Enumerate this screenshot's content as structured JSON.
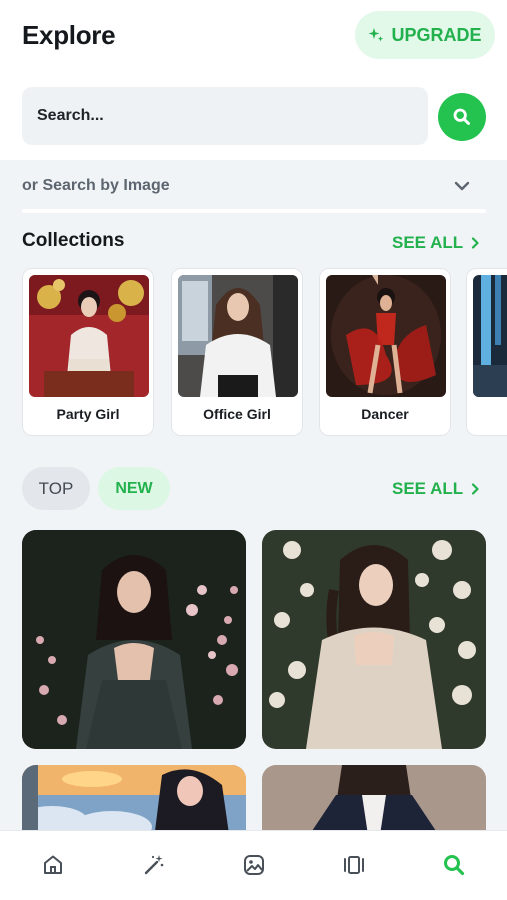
{
  "header": {
    "title": "Explore",
    "upgrade_label": "UPGRADE"
  },
  "search": {
    "placeholder": "Search...",
    "image_search_label": "or Search by Image"
  },
  "collections": {
    "title": "Collections",
    "see_all_label": "SEE ALL",
    "items": [
      {
        "label": "Party Girl"
      },
      {
        "label": "Office Girl"
      },
      {
        "label": "Dancer"
      },
      {
        "label": ""
      }
    ]
  },
  "feed": {
    "tabs": [
      {
        "label": "TOP",
        "selected": false
      },
      {
        "label": "NEW",
        "selected": true
      }
    ],
    "see_all_label": "SEE ALL"
  },
  "bottom_nav": {
    "items": [
      {
        "icon": "home-icon",
        "active": false
      },
      {
        "icon": "magic-wand-icon",
        "active": false
      },
      {
        "icon": "image-icon",
        "active": false
      },
      {
        "icon": "carousel-icon",
        "active": false
      },
      {
        "icon": "search-icon",
        "active": true
      }
    ]
  },
  "colors": {
    "accent": "#24c24f",
    "accent_soft": "#e2f8e9",
    "background": "#f1f4f7",
    "text": "#15181c"
  }
}
